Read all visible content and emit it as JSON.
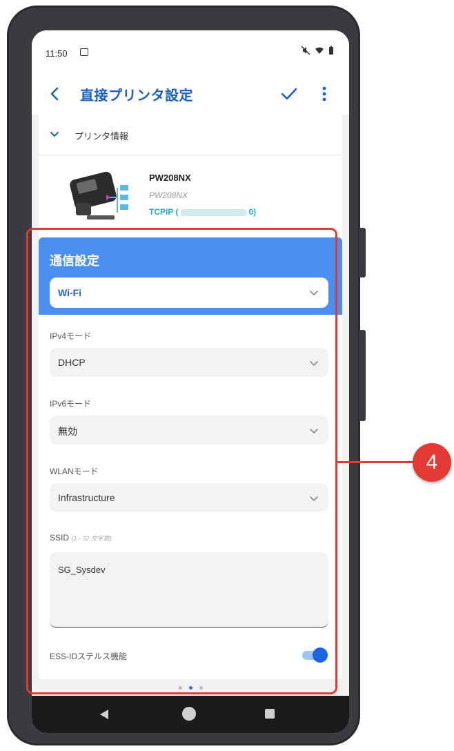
{
  "status_bar": {
    "time": "11:50"
  },
  "toolbar": {
    "title": "直接プリンタ設定"
  },
  "printer_info": {
    "section_label": "プリンタ情報",
    "name": "PW208NX",
    "model": "PW208NX",
    "connection_prefix": "TCPIP (",
    "connection_suffix": "0)"
  },
  "comm_settings": {
    "title": "通信設定",
    "interface_value": "Wi-Fi",
    "ipv4_label": "IPv4モード",
    "ipv4_value": "DHCP",
    "ipv6_label": "IPv6モード",
    "ipv6_value": "無効",
    "wlan_label": "WLANモード",
    "wlan_value": "Infrastructure",
    "ssid_label": "SSID",
    "ssid_hint": "(1 - 32 文字数)",
    "ssid_value": "SG_Sysdev",
    "stealth_label": "ESS-IDステルス機能",
    "stealth_enabled": true
  },
  "pager": {
    "active_page": 2,
    "total_pages": 3
  },
  "annotation": {
    "badge": "4"
  },
  "colors": {
    "accent": "#4a8ef0",
    "title_blue": "#1a5fc5",
    "annotation_red": "#e53935",
    "connection_teal": "#1ab2b8"
  }
}
